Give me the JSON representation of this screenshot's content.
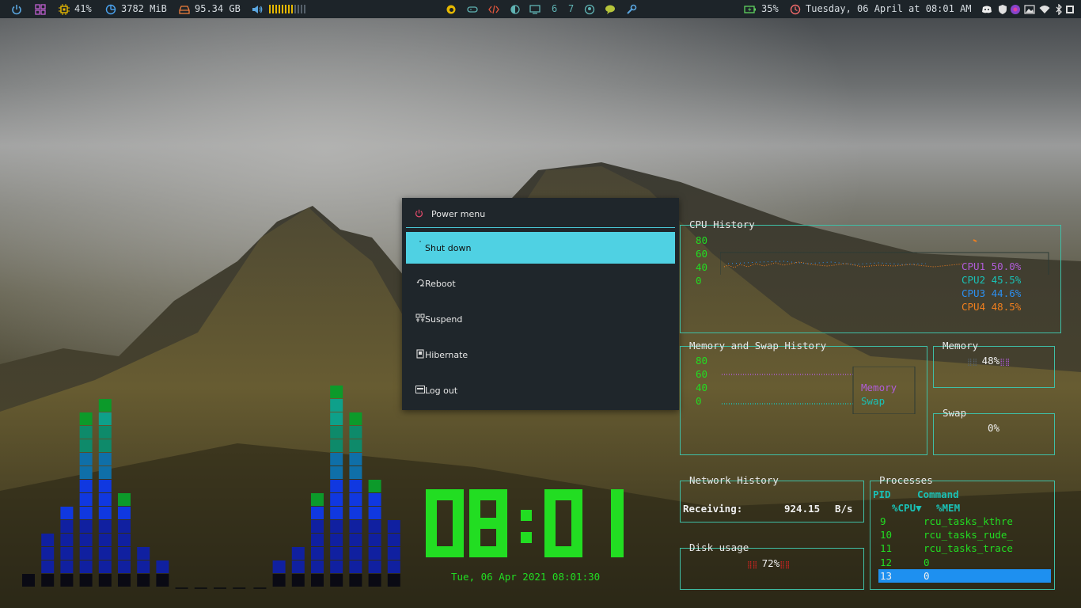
{
  "topbar": {
    "cpu_usage": "41%",
    "memory_used": "3782 MiB",
    "disk_free": "95.34 GB",
    "volume_level": 0.7,
    "workspaces": [
      "6",
      "7"
    ],
    "battery": "35%",
    "datetime": "Tuesday, 06 April at 08:01 AM",
    "colors": {
      "power": "#5aa6e0",
      "grid": "#c060d0",
      "cpu": "#e6b800",
      "mem": "#4aa3f0",
      "disk": "#f07e3c",
      "battery": "#5fd35f",
      "clock": "#f06a6a"
    }
  },
  "power_menu": {
    "title": "Power menu",
    "items": [
      {
        "label": "Shut down",
        "icon": "power-icon"
      },
      {
        "label": "Reboot",
        "icon": "reboot-icon"
      },
      {
        "label": "Suspend",
        "icon": "suspend-icon"
      },
      {
        "label": "Hibernate",
        "icon": "hibernate-icon"
      },
      {
        "label": "Log out",
        "icon": "logout-icon"
      }
    ],
    "selected_index": 0
  },
  "cpu_history": {
    "title": "CPU History",
    "y_ticks": [
      "80",
      "60",
      "40",
      "0"
    ],
    "cores": [
      {
        "name": "CPU1",
        "value": "50.0%",
        "color": "#b05cd8"
      },
      {
        "name": "CPU2",
        "value": "45.5%",
        "color": "#19c1b6"
      },
      {
        "name": "CPU3",
        "value": "44.6%",
        "color": "#2c8ff0"
      },
      {
        "name": "CPU4",
        "value": "48.5%",
        "color": "#f07f1e"
      }
    ]
  },
  "mem_history": {
    "title": "Memory and Swap History",
    "y_ticks": [
      "80",
      "60",
      "40",
      "0"
    ],
    "legend": [
      {
        "name": "Memory",
        "color": "#b05cd8"
      },
      {
        "name": "Swap",
        "color": "#19c1b6"
      }
    ]
  },
  "memory": {
    "title": "Memory",
    "value": "48%"
  },
  "swap": {
    "title": "Swap",
    "value": "0%"
  },
  "network": {
    "title": "Network History",
    "label": "Receiving:",
    "value": "924.15",
    "unit": "B/s"
  },
  "disk": {
    "title": "Disk usage",
    "value": "72%"
  },
  "processes": {
    "title": "Processes",
    "headers": {
      "pid": "PID",
      "command": "Command",
      "cpu": "%CPU▼",
      "mem": "%MEM"
    },
    "rows": [
      {
        "pid": "9",
        "command": "rcu_tasks_kthre"
      },
      {
        "pid": "10",
        "command": "rcu_tasks_rude_"
      },
      {
        "pid": "11",
        "command": "rcu_tasks_trace"
      },
      {
        "pid": "12",
        "command": "0"
      },
      {
        "pid": "13",
        "command": "0"
      }
    ],
    "selected_row": 4
  },
  "clock": {
    "time": "08:01",
    "date": "Tue, 06 Apr 2021 08:01:30"
  }
}
